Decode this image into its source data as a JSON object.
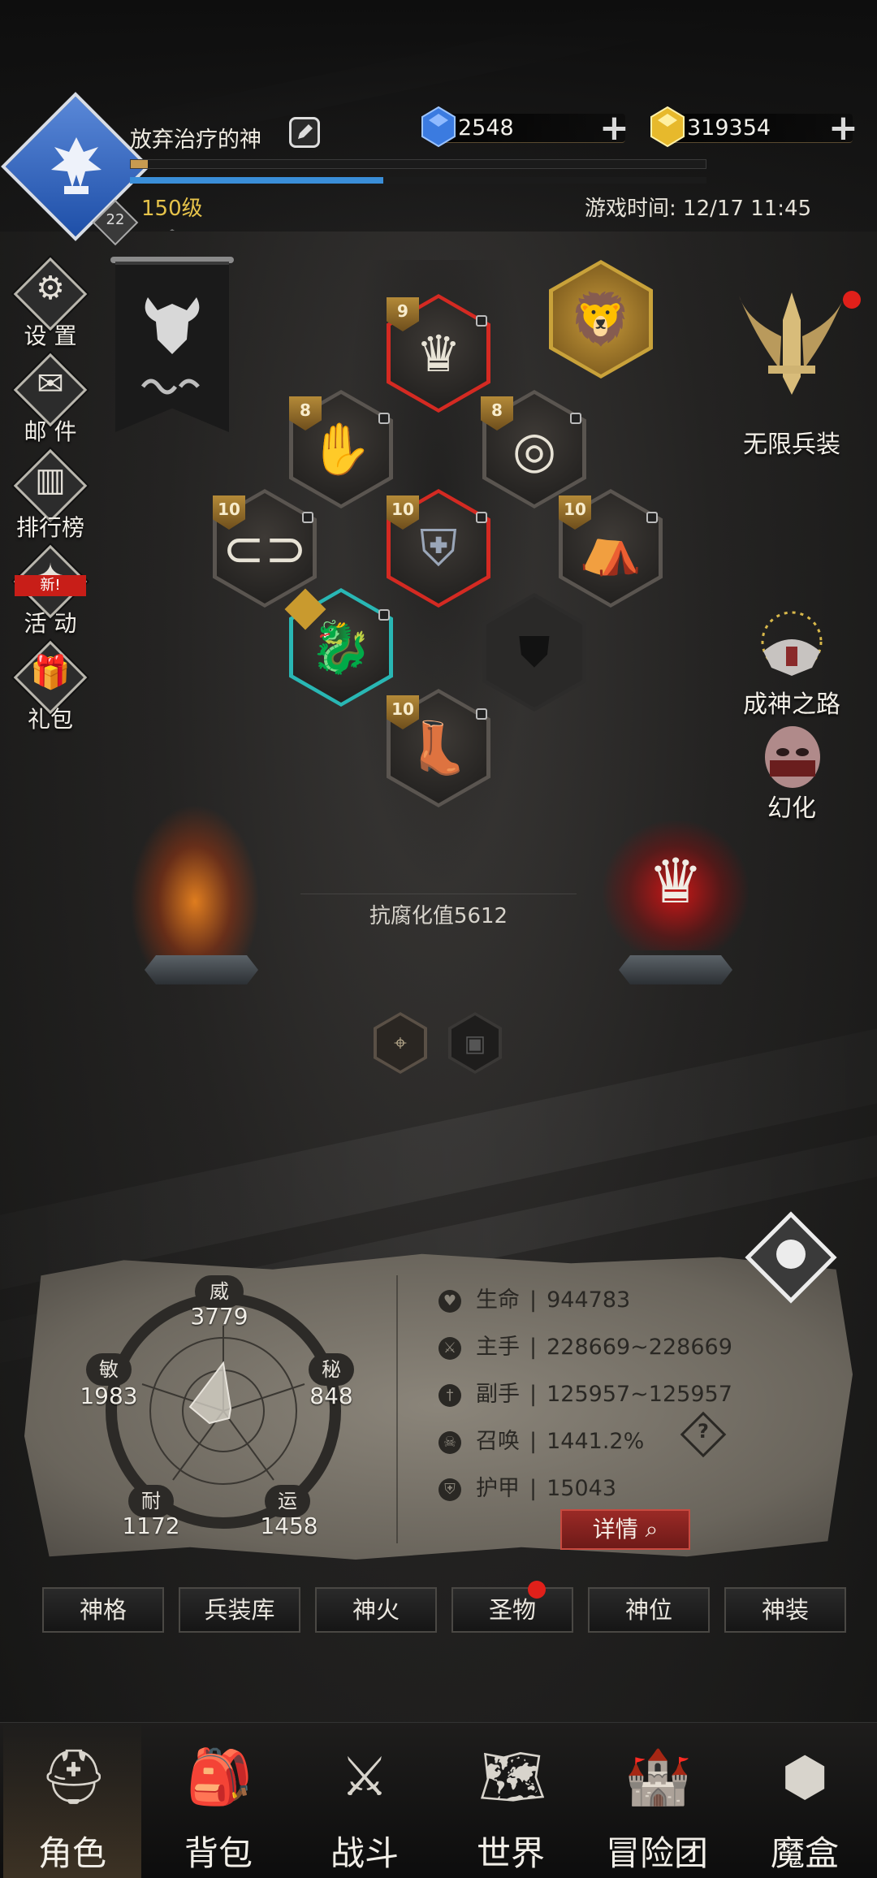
{
  "player": {
    "name": "放弃治疗的神",
    "level_text": "150级",
    "avatar_level": "22",
    "exp_progress": 0.03,
    "mana_progress": 0.44
  },
  "currencies": [
    {
      "name": "diamond",
      "value": "2548",
      "color": "#3b7be0"
    },
    {
      "name": "gold-gem",
      "value": "319354",
      "color": "#e7b92c"
    }
  ],
  "game_time": "游戏时间: 12/17 11:45",
  "side_menu": [
    {
      "label": "设 置",
      "icon": "gear-icon"
    },
    {
      "label": "邮 件",
      "icon": "envelope-icon"
    },
    {
      "label": "排行榜",
      "icon": "ranking-icon"
    },
    {
      "label": "活 动",
      "icon": "event-icon",
      "badge": "新!"
    },
    {
      "label": "礼包",
      "icon": "gift-icon"
    }
  ],
  "equipment": {
    "helmet_level": "9",
    "gloves_level": "8",
    "ring_level": "8",
    "belt_level": "10",
    "armor_level": "10",
    "cloak_level": "10",
    "boots_level": "10"
  },
  "right_menu": {
    "infinite_weapon": "无限兵装",
    "path_to_god": "成神之路",
    "transform": "幻化"
  },
  "resistance": "抗腐化值5612",
  "attributes": {
    "wei_label": "威",
    "wei_value": "3779",
    "mi_label": "秘",
    "mi_value": "848",
    "yun_label": "运",
    "yun_value": "1458",
    "nai_label": "耐",
    "nai_value": "1172",
    "min_label": "敏",
    "min_value": "1983"
  },
  "stats": [
    {
      "label": "生命",
      "value": "944783"
    },
    {
      "label": "主手",
      "value": "228669~228669"
    },
    {
      "label": "副手",
      "value": "125957~125957"
    },
    {
      "label": "召唤",
      "value": "1441.2%"
    },
    {
      "label": "护甲",
      "value": "15043"
    }
  ],
  "help_symbol": "?",
  "detail_button": "详情",
  "sub_tabs": [
    "神格",
    "兵装库",
    "神火",
    "圣物",
    "神位",
    "神装"
  ],
  "bottom_nav": [
    "角色",
    "背包",
    "战斗",
    "世界",
    "冒险团",
    "魔盒"
  ]
}
